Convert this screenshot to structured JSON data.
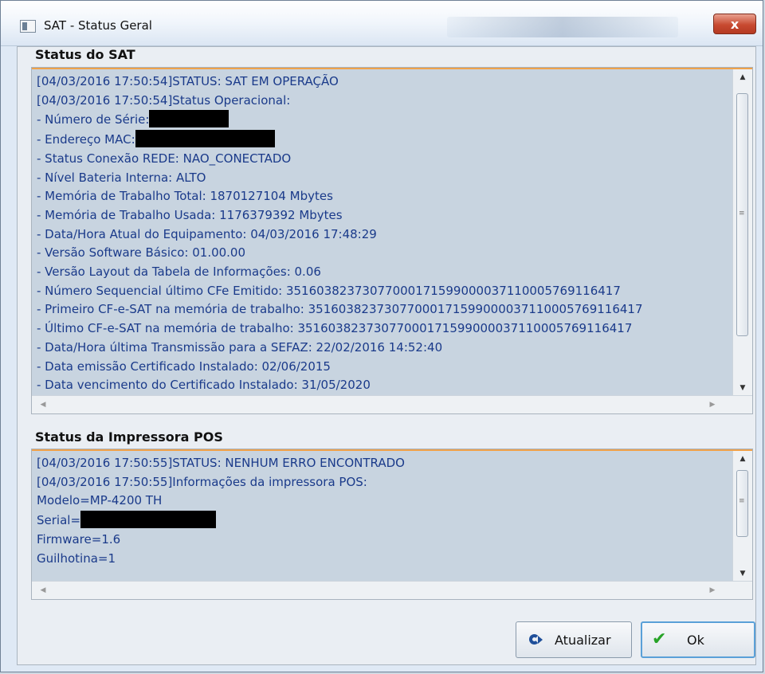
{
  "window": {
    "title": "SAT - Status Geral",
    "close_label": "x"
  },
  "sat_section": {
    "label": "Status do SAT",
    "lines": [
      "[04/03/2016 17:50:54]STATUS: SAT EM OPERAÇÃO",
      "[04/03/2016 17:50:54]Status Operacional:",
      "- Número de Série:",
      "- Endereço MAC:",
      "- Status Conexão REDE: NAO_CONECTADO",
      "- Nível Bateria Interna: ALTO",
      "- Memória de Trabalho Total: 1870127104 Mbytes",
      "- Memória de Trabalho Usada: 1176379392 Mbytes",
      "- Data/Hora Atual do Equipamento: 04/03/2016 17:48:29",
      "- Versão Software Básico: 01.00.00",
      "- Versão Layout da Tabela de Informações: 0.06",
      "- Número Sequencial último CFe Emitido: 35160382373077000171599000037110005769116417",
      "- Primeiro CF-e-SAT na memória de trabalho: 35160382373077000171599000037110005769116417",
      "- Último CF-e-SAT na memória de trabalho: 35160382373077000171599000037110005769116417",
      "- Data/Hora última Transmissão para a SEFAZ: 22/02/2016 14:52:40",
      "- Data emissão Certificado Instalado: 02/06/2015",
      "- Data vencimento do Certificado Instalado: 31/05/2020"
    ],
    "scroll_position": 0.1
  },
  "pos_section": {
    "label": "Status da Impressora POS",
    "lines": [
      "[04/03/2016 17:50:55]STATUS: NENHUM ERRO ENCONTRADO",
      "[04/03/2016 17:50:55]Informações da impressora POS:",
      "Modelo=MP-4200 TH",
      "Serial=",
      "Firmware=1.6",
      "Guilhotina=1"
    ],
    "scroll_position": 0.1
  },
  "buttons": {
    "refresh_label": "Atualizar",
    "ok_label": "Ok"
  },
  "colors": {
    "text_blue": "#1a3a8a",
    "panel_bg": "#c8d4e0",
    "accent_orange": "#f0a24a"
  },
  "icons": {
    "refresh": "refresh-icon",
    "ok": "check-icon",
    "app": "app-icon",
    "close": "close-icon"
  }
}
